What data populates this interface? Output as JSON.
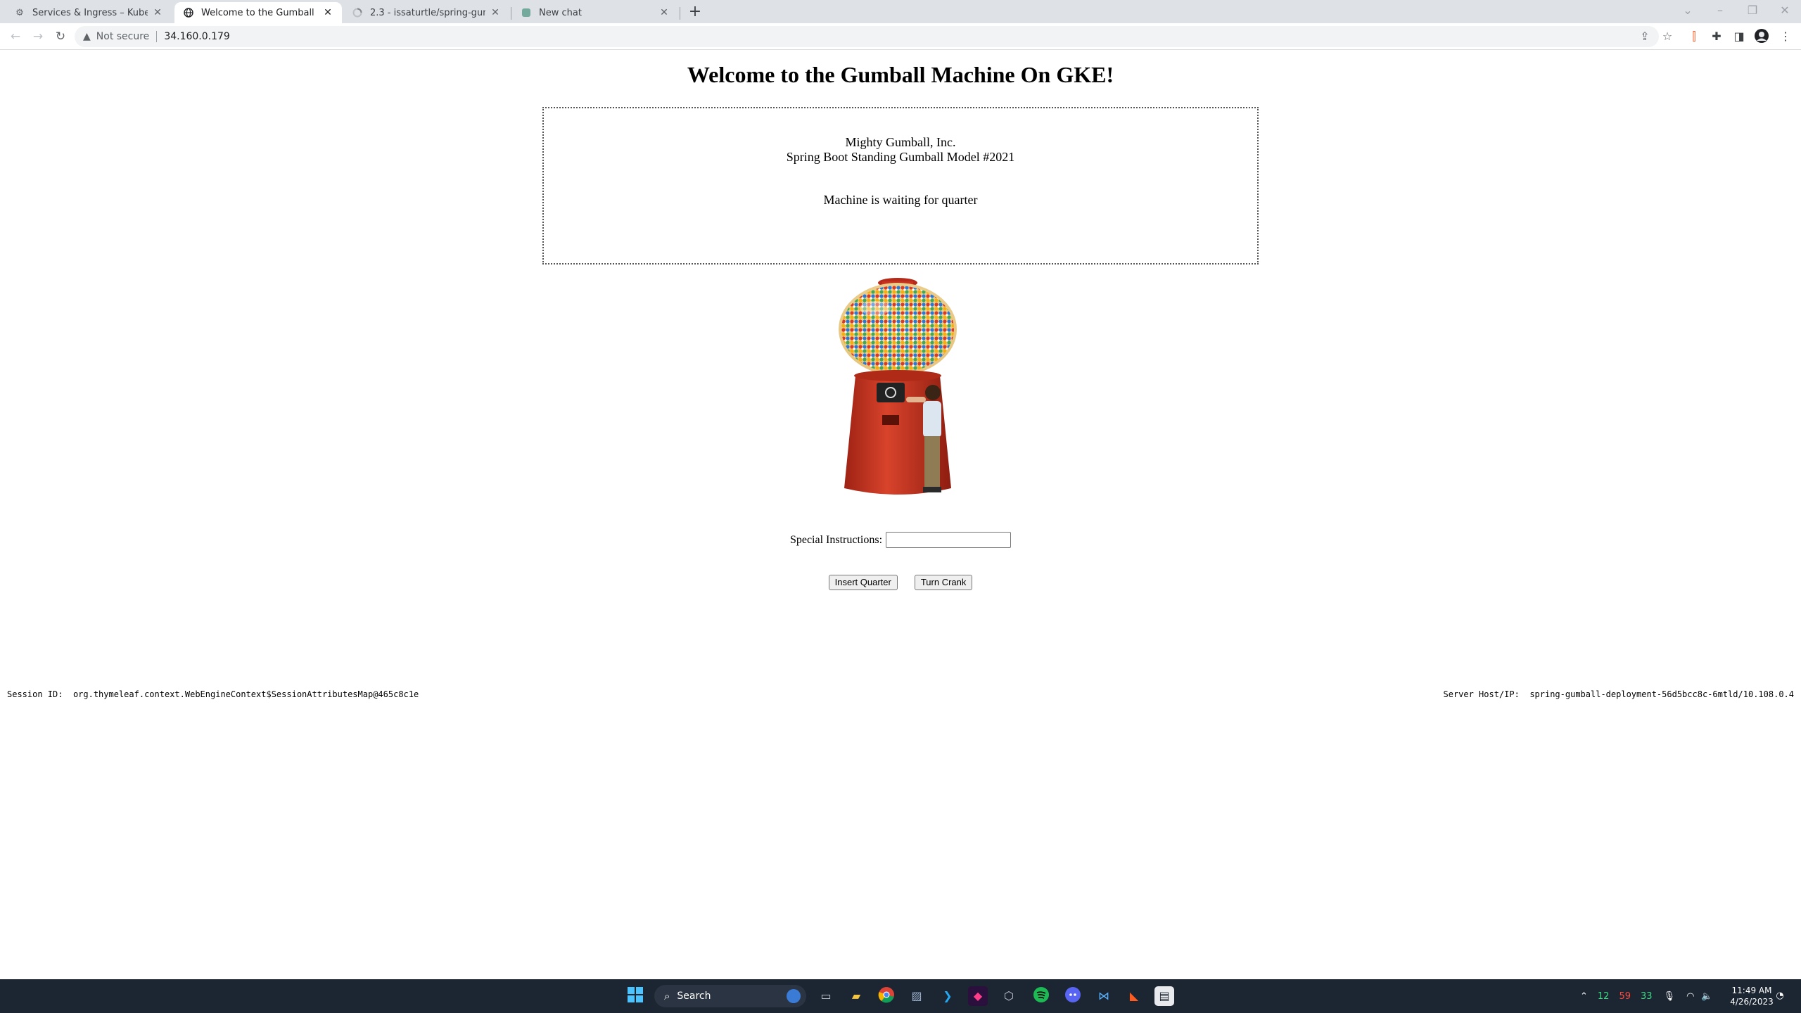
{
  "browser": {
    "tabs": [
      {
        "title": "Services & Ingress – Kubernetes",
        "favicon": "gear-icon",
        "active": false
      },
      {
        "title": "Welcome to the Gumball Machine",
        "favicon": "globe-icon",
        "active": true
      },
      {
        "title": "2.3 - issaturtle/spring-gumball",
        "favicon": "loading-icon",
        "active": false
      },
      {
        "title": "New chat",
        "favicon": "chat-icon",
        "active": false
      }
    ],
    "security_label": "Not secure",
    "url": "34.160.0.179"
  },
  "page": {
    "title": "Welcome to the Gumball Machine On GKE!",
    "company": "Mighty Gumball, Inc.",
    "model": "Spring Boot Standing Gumball Model #2021",
    "state": "Machine is waiting for quarter",
    "instructions_label": "Special Instructions:",
    "instructions_value": "",
    "insert_button": "Insert Quarter",
    "crank_button": "Turn Crank",
    "session_label": "Session ID:",
    "session_value": "org.thymeleaf.context.WebEngineContext$SessionAttributesMap@465c8c1e",
    "server_label": "Server Host/IP:",
    "server_value": "spring-gumball-deployment-56d5bcc8c-6mtld/10.108.0.4"
  },
  "taskbar": {
    "search_label": "Search",
    "tray_numbers": [
      "12",
      "59",
      "33"
    ],
    "time": "11:49 AM",
    "date": "4/26/2023"
  },
  "colors": {
    "taskbar_bg": "#1c2532",
    "gumball_red": "#c8331f",
    "tabstrip_bg": "#dee1e6"
  }
}
